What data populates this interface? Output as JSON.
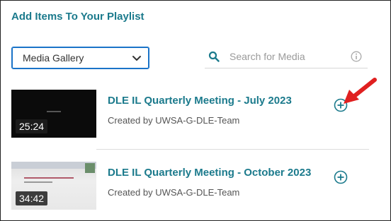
{
  "panel": {
    "title": "Add Items To Your Playlist"
  },
  "source_select": {
    "selected": "Media Gallery",
    "icon": "chevron-down-icon"
  },
  "search": {
    "placeholder": "Search for Media",
    "icon": "search-icon",
    "info_icon": "info-icon"
  },
  "media_items": [
    {
      "title": "DLE IL Quarterly Meeting - July 2023",
      "creator": "Created by UWSA-G-DLE-Team",
      "duration": "25:24",
      "add_icon": "add-circle-icon"
    },
    {
      "title": "DLE IL Quarterly Meeting - October 2023",
      "creator": "Created by UWSA-G-DLE-Team",
      "duration": "34:42",
      "add_icon": "add-circle-icon"
    }
  ],
  "colors": {
    "accent": "#1b7a8c",
    "select_border": "#1a73c8",
    "annotation_arrow": "#e02020"
  }
}
